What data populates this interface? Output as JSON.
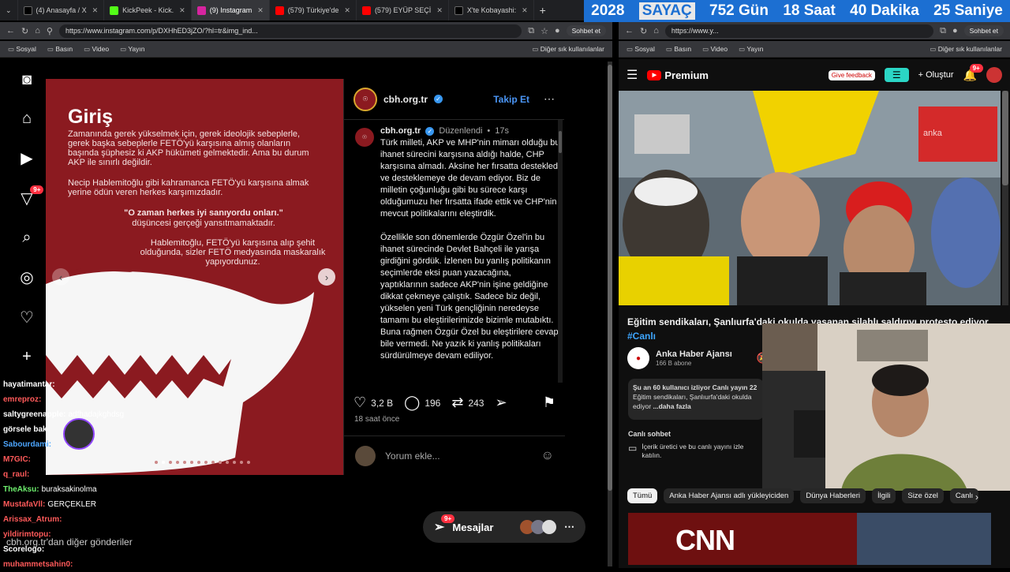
{
  "browser": {
    "tabs": [
      {
        "label": "(4) Anasayfa / X",
        "color": "#000000"
      },
      {
        "label": "KickPeek - Kick.",
        "color": "#2d2d2d"
      },
      {
        "label": "(9) Instagram",
        "color": "#d6249f"
      },
      {
        "label": "(579) Türkiye'de",
        "color": "#ff0000"
      },
      {
        "label": "(579) EYÜP SEÇİ",
        "color": "#ff0000"
      },
      {
        "label": "X'te Kobayashi:",
        "color": "#000000"
      }
    ],
    "left_url": "https://www.instagram.com/p/DXHhED3jZO/?hl=tr&img_ind...",
    "right_url": "https://www.y...",
    "chat_button": "Sohbet et",
    "bookmarks": [
      "Sosyal",
      "Basın",
      "Video",
      "Yayın"
    ],
    "bookmarks_other": "Diğer sık kullanılanlar"
  },
  "countdown": {
    "year": "2028",
    "label": "SAYAÇ",
    "days": "752 Gün",
    "hours": "18 Saat",
    "minutes": "40 Dakika",
    "seconds": "25 Saniye"
  },
  "instagram": {
    "sidebar_icons": [
      "instagram-icon",
      "home-icon",
      "reels-icon",
      "notifications-icon",
      "search-icon",
      "explore-icon",
      "heart-icon",
      "create-icon"
    ],
    "notif_badge": "9+",
    "post_image": {
      "title": "Giriş",
      "para1": "Zamanında gerek yükselmek için, gerek ideolojik sebeplerle, gerek başka sebeplerle FETÖ'yü karşısına almış olanların başında şüphesiz ki AKP hükümeti gelmektedir. Ama bu durum AKP ile sınırlı değildir.",
      "para2": "Necip Hablemitoğlu gibi kahramanca FETÖ'yü karşısına almak yerine ödün veren herkes karşımızdadır.",
      "quote": "\"O zaman herkes iyi sanıyordu onları.\"",
      "quote2": "düşüncesi gerçeği yansıtmamaktadır.",
      "para3": "Hablemitoğlu, FETÖ'yü karşısına alıp şehit olduğunda, sizler FETÖ medyasında maskaralık yapıyordunuz."
    },
    "account": "cbh.org.tr",
    "follow": "Takip Et",
    "edited": "Düzenlendi",
    "dot": "•",
    "time": "17s",
    "caption_p1": "Türk milleti, AKP ve MHP'nin mimarı olduğu bu ihanet sürecini karşısına aldığı halde, CHP karşısına almadı. Aksine her fırsatta destekledi ve desteklemeye de devam ediyor. Biz de milletin çoğunluğu gibi bu sürece karşı olduğumuzu her fırsatta ifade ettik ve CHP'nin mevcut politikalarını eleştirdik.",
    "caption_p2": "Özellikle son dönemlerde Özgür Özel'in bu ihanet sürecinde Devlet Bahçeli ile yarışa girdiğini gördük. İzlenen bu yanlış politikanın seçimlerde eksi puan yazacağına, yaptıklarının sadece AKP'nin işine geldiğine dikkat çekmeye çalıştık. Sadece biz değil, yükselen yeni Türk gençliğinin neredeyse tamamı bu eleştirilerimizde bizimle mutabıktı. Buna rağmen Özgür Özel bu eleştirilere cevap bile vermedi. Ne yazık ki yanlış politikaları sürdürülmeye devam ediliyor.",
    "likes": "3,2 B",
    "comments": "196",
    "reposts": "243",
    "posted": "18 saat önce",
    "comment_placeholder": "Yorum ekle...",
    "more_from": "cbh.org.tr'dan diğer gönderiler",
    "messages": "Mesajlar",
    "messages_badge": "9+"
  },
  "chat_overlay": [
    {
      "user": "hayatimantar:",
      "msg": "",
      "color": "#ffffff"
    },
    {
      "user": "emreproz:",
      "msg": "",
      "color": "#ff5a5a"
    },
    {
      "user": "saltygreenapple:",
      "msg": "adfhadajkghdsg",
      "color": "#ffffff"
    },
    {
      "user": "görsele bak",
      "msg": "",
      "color": "#ffffff"
    },
    {
      "user": "Sabourdami:",
      "msg": "",
      "color": "#4da6ff"
    },
    {
      "user": "M7GIC:",
      "msg": "",
      "color": "#ff5a5a"
    },
    {
      "user": "q_raul:",
      "msg": "",
      "color": "#ff5a5a"
    },
    {
      "user": "TheAksu:",
      "msg": "buraksakinolma",
      "color": "#6ef06e"
    },
    {
      "user": "MustafaVll:",
      "msg": "GERÇEKLER",
      "color": "#ff5a5a"
    },
    {
      "user": "Arissax_Atrum:",
      "msg": "",
      "color": "#ff5a5a"
    },
    {
      "user": "yildirimtopu:",
      "msg": "",
      "color": "#ff5a5a"
    },
    {
      "user": "Scorelogo:",
      "msg": "",
      "color": "#ffffff"
    },
    {
      "user": "muhammetsahin0:",
      "msg": "",
      "color": "#ff5a5a"
    }
  ],
  "youtube": {
    "logo": "Premium",
    "feedback": "Give feedback",
    "create": "Oluştur",
    "notif_badge": "9+",
    "title": "Eğitim sendikaları, Şanlıurfa'daki okulda yaşanan silahlı saldırıyı protesto ediyor",
    "hashtag": "#Canlı",
    "channel": "Anka Haber Ajansı",
    "subscribers": "166 B abone",
    "watching": "Şu an 60 kullanıcı izliyor  Canlı yayın 22",
    "desc": "Eğitim sendikaları, Şanlıurfa'daki okulda",
    "desc2": "ediyor",
    "more": "...daha fazla",
    "live_chat": "Canlı sohbet",
    "live_chat_desc": "İçerik üretici ve bu canlı yayını izle katılın.",
    "chips": [
      "Tümü",
      "Anka Haber Ajansı adlı yükleyiciden",
      "Dünya Haberleri",
      "İlgili",
      "Size özel",
      "Canlı"
    ],
    "thumb_logo": "CNN",
    "video_watermark": "anka"
  }
}
